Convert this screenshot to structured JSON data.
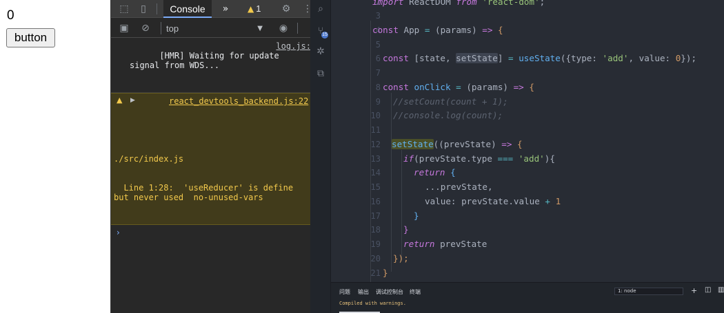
{
  "app": {
    "count": "0",
    "button_label": "button"
  },
  "devtools": {
    "toolbar": {
      "active_tab": "Console",
      "more_tabs_icon": "double-chevron-right-icon",
      "warning_count": "1"
    },
    "filterbar": {
      "context": "top"
    },
    "console": {
      "messages": [
        {
          "level": "info",
          "text": "[HMR] Waiting for update\nsignal from WDS...",
          "source": "log.js:"
        },
        {
          "level": "warning",
          "source": "react_devtools_backend.js:22",
          "file": "./src/index.js",
          "text": "  Line 1:28:  'useReducer' is define\nbut never used  no-unused-vars"
        }
      ],
      "prompt": "›"
    }
  },
  "vscode": {
    "editor": {
      "lines": [
        {
          "n": "2"
        },
        {
          "n": "3"
        },
        {
          "n": "4"
        },
        {
          "n": "5"
        },
        {
          "n": "6"
        },
        {
          "n": "7"
        },
        {
          "n": "8"
        },
        {
          "n": "9"
        },
        {
          "n": "10"
        },
        {
          "n": "11"
        },
        {
          "n": "12"
        },
        {
          "n": "13"
        },
        {
          "n": "14"
        },
        {
          "n": "15"
        },
        {
          "n": "16"
        },
        {
          "n": "17"
        },
        {
          "n": "18"
        },
        {
          "n": "19"
        },
        {
          "n": "20"
        },
        {
          "n": "21"
        }
      ],
      "code": {
        "l2_kw": "import",
        "l2_name": " ReactDOM ",
        "l2_from": "from",
        "l2_str": " 'react-dom'",
        "l2_end": ";",
        "l4_kw": "const",
        "l4_name": " App ",
        "l4_op": "=",
        "l4_params": " (params) ",
        "l4_arrow": "=>",
        "l4_brace": " {",
        "l6_kw": "const",
        "l6_a": " [state, ",
        "l6_set": "setState",
        "l6_b": "] ",
        "l6_op": "=",
        "l6_fn": " useState",
        "l6_c": "({type: ",
        "l6_str": "'add'",
        "l6_d": ", value: ",
        "l6_num": "0",
        "l6_e": "});",
        "l8_kw": "const",
        "l8_fn": " onClick",
        "l8_op": " =",
        "l8_params": " (params) ",
        "l8_arrow": "=>",
        "l8_brace": " {",
        "l9_cm": "//setCount(count + 1);",
        "l10_cm": "//console.log(count);",
        "l12_fn": "setState",
        "l12_a": "((prevState) ",
        "l12_arrow": "=>",
        "l12_brace": " {",
        "l13_kw": "if",
        "l13_a": "(prevState.type ",
        "l13_op": "===",
        "l13_str": " 'add'",
        "l13_b": "){",
        "l14_kw": "return",
        "l14_brace": " {",
        "l15_a": "...prevState,",
        "l16_a": "value: prevState.value ",
        "l16_op": "+",
        "l16_num": " 1",
        "l17_a": "}",
        "l18_a": "}",
        "l19_kw": "return",
        "l19_a": " prevState",
        "l20_a": "});",
        "l21_a": "}"
      }
    },
    "panel": {
      "tabs": [
        "问题",
        "输出",
        "调试控制台",
        "终端"
      ],
      "terminal_select": "1: node",
      "status_text": "Compiled with warnings."
    }
  }
}
